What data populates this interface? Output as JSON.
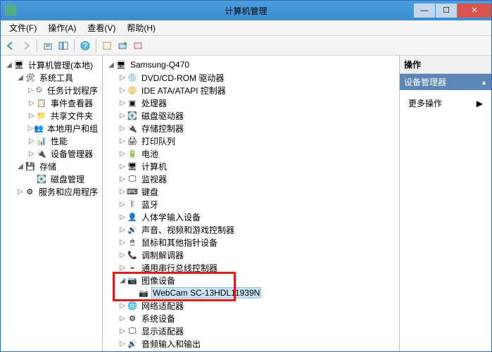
{
  "window": {
    "title": "计算机管理"
  },
  "menu": {
    "file": "文件(F)",
    "action": "操作(A)",
    "view": "查看(V)",
    "help": "帮助(H)"
  },
  "left_tree": {
    "root": "计算机管理(本地)",
    "groups": [
      {
        "label": "系统工具",
        "children": [
          "任务计划程序",
          "事件查看器",
          "共享文件夹",
          "本地用户和组",
          "性能",
          "设备管理器"
        ]
      },
      {
        "label": "存储",
        "children": [
          "磁盘管理"
        ]
      },
      {
        "label": "服务和应用程序",
        "children": []
      }
    ]
  },
  "center_tree": {
    "root": "Samsung-Q470",
    "categories": [
      "DVD/CD-ROM 驱动器",
      "IDE ATA/ATAPI 控制器",
      "处理器",
      "磁盘驱动器",
      "存储控制器",
      "打印队列",
      "电池",
      "计算机",
      "监视器",
      "键盘",
      "蓝牙",
      "人体学输入设备",
      "声音、视频和游戏控制器",
      "鼠标和其他指针设备",
      "调制解调器",
      "通用串行总线控制器"
    ],
    "imaging": {
      "label": "图像设备",
      "device": "WebCam SC-13HDL11939N"
    },
    "categories_after": [
      "网络适配器",
      "系统设备",
      "显示适配器",
      "音频输入和输出"
    ]
  },
  "right": {
    "header": "操作",
    "section": "设备管理器",
    "more": "更多操作"
  },
  "icons": {
    "computer": "🖥",
    "folder": "📁",
    "gear": "⚙",
    "disk": "💽",
    "service": "🔧",
    "device": "🔌",
    "monitor": "🖵",
    "keyboard": "⌨",
    "bt": "ᛒ",
    "sound": "🔊",
    "mouse": "🖱",
    "usb": "⌁",
    "camera": "📷",
    "net": "🌐",
    "display": "🖵",
    "cpu": "▣",
    "printer": "🖨",
    "battery": "🔋",
    "hid": "👤",
    "modem": "📞",
    "dvd": "💿",
    "atapi": "📀"
  }
}
